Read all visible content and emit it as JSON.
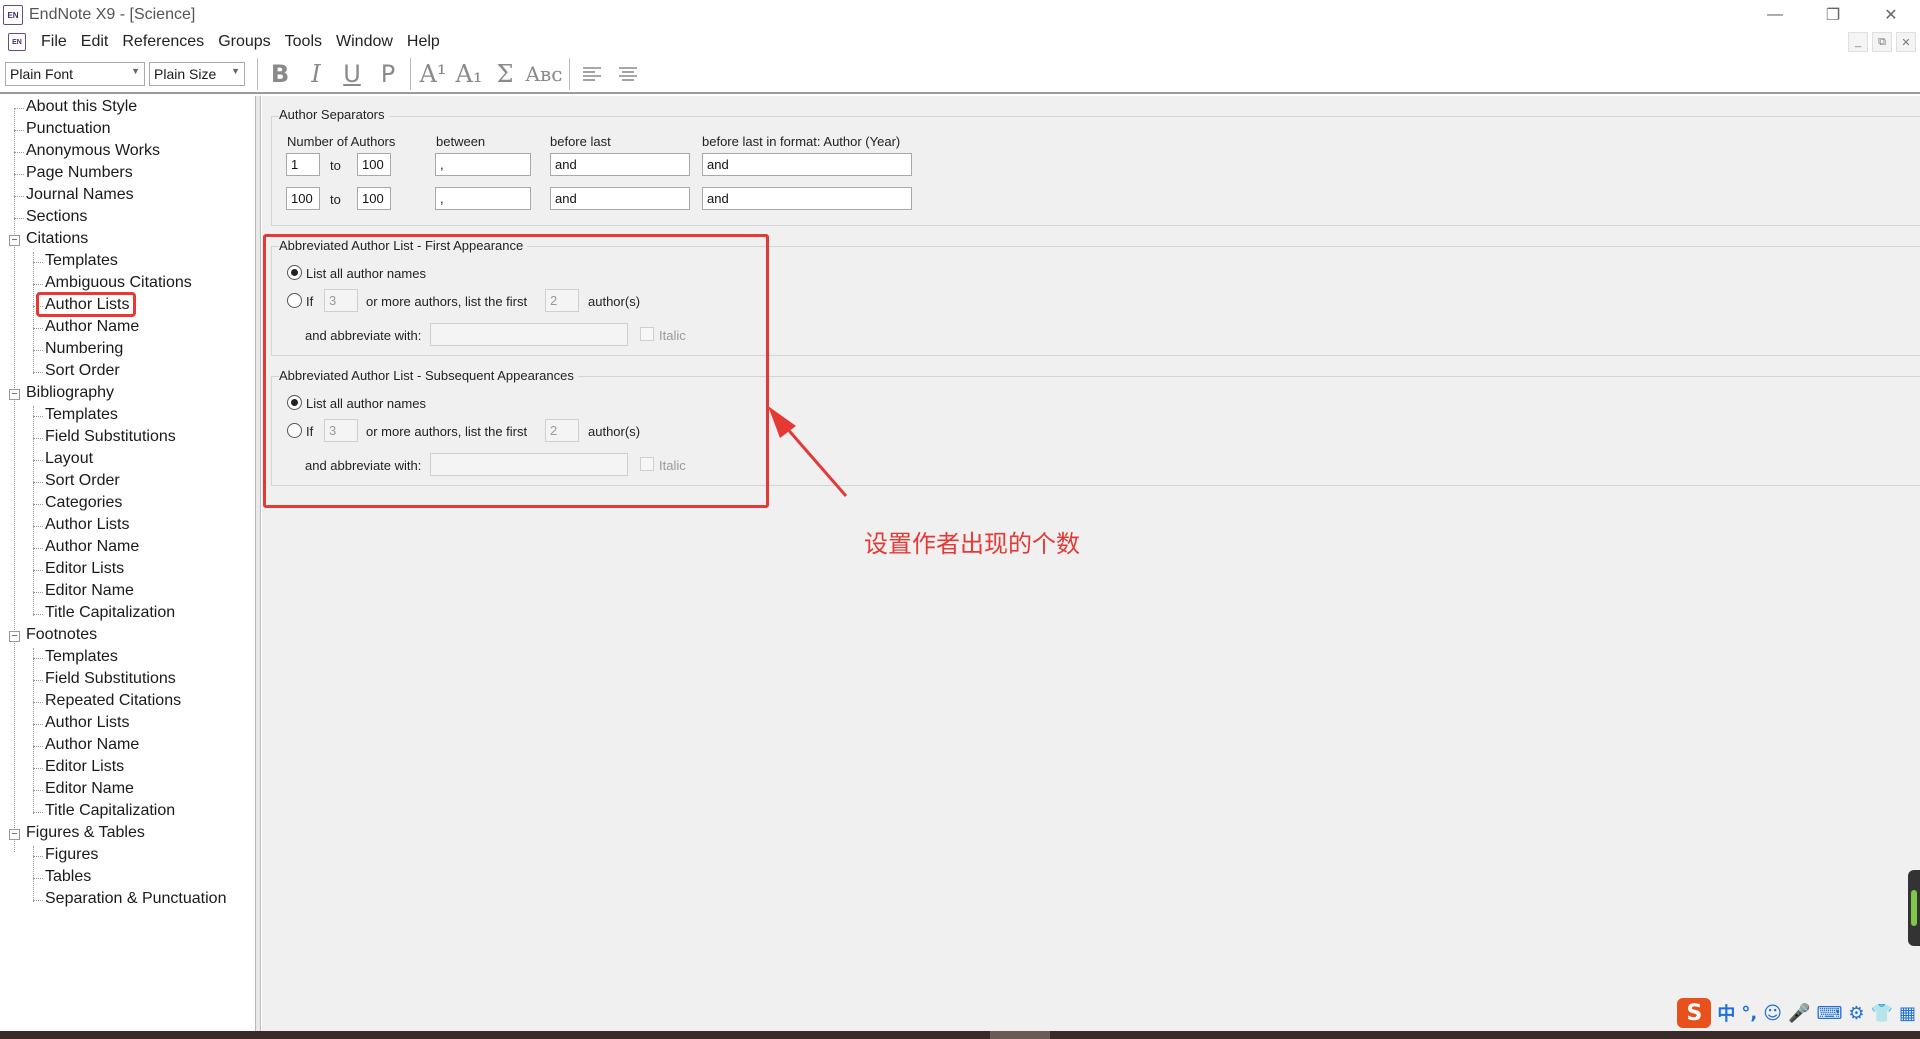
{
  "window": {
    "app_logo": "EN",
    "title": "EndNote X9 - [Science]",
    "controls": {
      "minimize": "—",
      "restore": "❐",
      "close": "✕"
    },
    "mdi_controls": {
      "minimize": "_",
      "restore": "⧉",
      "close": "✕"
    }
  },
  "menu": [
    "File",
    "Edit",
    "References",
    "Groups",
    "Tools",
    "Window",
    "Help"
  ],
  "toolbar": {
    "font_combo": "Plain Font",
    "size_combo": "Plain Size",
    "bold": "B",
    "italic": "I",
    "underline": "U",
    "plain": "P",
    "superscript": "A¹",
    "subscript": "A₁",
    "symbol": "Σ",
    "smallcaps": "Aʙᴄ"
  },
  "tree": {
    "top_items": [
      "About this Style",
      "Punctuation",
      "Anonymous Works",
      "Page Numbers",
      "Journal Names",
      "Sections"
    ],
    "citations": {
      "label": "Citations",
      "children": [
        "Templates",
        "Ambiguous Citations",
        "Author Lists",
        "Author Name",
        "Numbering",
        "Sort Order"
      ]
    },
    "bibliography": {
      "label": "Bibliography",
      "children": [
        "Templates",
        "Field Substitutions",
        "Layout",
        "Sort Order",
        "Categories",
        "Author Lists",
        "Author Name",
        "Editor Lists",
        "Editor Name",
        "Title Capitalization"
      ]
    },
    "footnotes": {
      "label": "Footnotes",
      "children": [
        "Templates",
        "Field Substitutions",
        "Repeated Citations",
        "Author Lists",
        "Author Name",
        "Editor Lists",
        "Editor Name",
        "Title Capitalization"
      ]
    },
    "figures": {
      "label": "Figures & Tables",
      "children": [
        "Figures",
        "Tables",
        "Separation & Punctuation"
      ]
    },
    "expander_symbol": "−"
  },
  "separators": {
    "title": "Author Separators",
    "col_number": "Number of Authors",
    "col_between": "between",
    "col_before_last": "before last",
    "col_before_last_format": "before last in format: Author (Year)",
    "to_label": "to",
    "rows": [
      {
        "from": "1",
        "to": "100",
        "between": ",",
        "before_last": "and",
        "before_last_format": "and"
      },
      {
        "from": "100",
        "to": "100",
        "between": ",",
        "before_last": "and",
        "before_last_format": "and"
      }
    ]
  },
  "first_appearance": {
    "title": "Abbreviated Author List - First Appearance",
    "list_all": "List all author names",
    "if_label": "If",
    "if_value": "3",
    "more_label": "or more authors, list the first",
    "first_value": "2",
    "authors_label": "author(s)",
    "abbreviate_label": "and abbreviate with:",
    "abbreviate_value": "",
    "italic_label": "Italic"
  },
  "subsequent": {
    "title": "Abbreviated Author List - Subsequent Appearances",
    "list_all": "List all author names",
    "if_label": "If",
    "if_value": "3",
    "more_label": "or more authors, list the first",
    "first_value": "2",
    "authors_label": "author(s)",
    "abbreviate_label": "and abbreviate with:",
    "abbreviate_value": "",
    "italic_label": "Italic"
  },
  "annotation": {
    "text": "设置作者出现的个数",
    "color": "#e53935"
  },
  "ime": {
    "logo": "S",
    "icons": [
      "中",
      "°,",
      "☺",
      "🎤",
      "⌨",
      "⚙",
      "👕",
      "▦"
    ]
  }
}
